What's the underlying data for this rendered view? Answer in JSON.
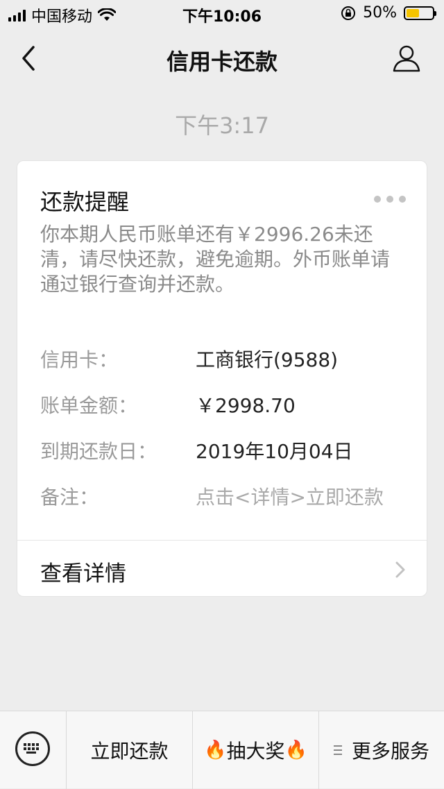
{
  "status_bar": {
    "carrier": "中国移动",
    "time": "下午10:06",
    "battery_percent": "50%",
    "battery_level": 0.5,
    "battery_color": "#f5c400"
  },
  "nav": {
    "title": "信用卡还款",
    "back_icon": "chevron-left-icon",
    "user_icon": "user-icon"
  },
  "message": {
    "timestamp": "下午3:17",
    "card": {
      "title": "还款提醒",
      "description": "你本期人民币账单还有￥2996.26未还清，请尽快还款，避免逾期。外币账单请通过银行查询并还款。",
      "rows": [
        {
          "label": "信用卡：",
          "value": "工商银行(9588)"
        },
        {
          "label": "账单金额：",
          "value": "￥2998.70"
        },
        {
          "label": "到期还款日：",
          "value": "2019年10月04日"
        },
        {
          "label": "备注：",
          "value": "点击<详情>立即还款"
        }
      ],
      "footer_label": "查看详情"
    }
  },
  "bottom_menu": {
    "keyboard_icon": "keyboard-icon",
    "items": [
      {
        "label": "立即还款"
      },
      {
        "label": "抽大奖",
        "prefix": "🔥",
        "suffix": "🔥"
      },
      {
        "label": "更多服务"
      }
    ]
  }
}
